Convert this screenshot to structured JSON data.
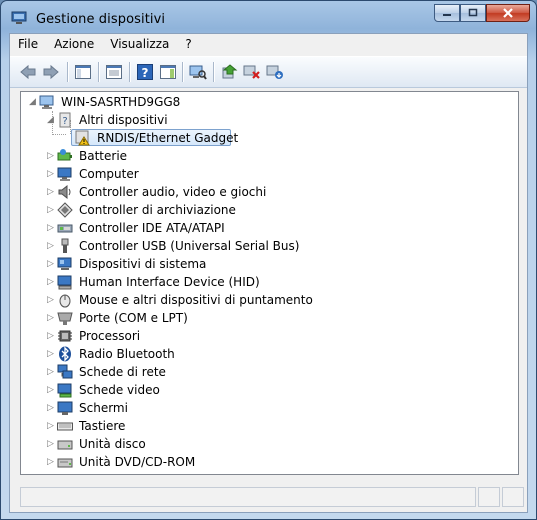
{
  "window": {
    "title": "Gestione dispositivi"
  },
  "menu": [
    "File",
    "Azione",
    "Visualizza",
    "?"
  ],
  "toolbar": {
    "buttons": [
      "back-icon",
      "forward-icon",
      "show-hide-console-tree-icon",
      "properties-icon",
      "help-icon",
      "action-pane-icon",
      "scan-hardware-icon",
      "update-driver-icon",
      "disable-device-icon",
      "uninstall-device-icon"
    ]
  },
  "tree": {
    "root": "WIN-SASRTHD9GG8",
    "expanded_category": "Altri dispositivi",
    "selected_device": "RNDIS/Ethernet Gadget",
    "categories": [
      "Batterie",
      "Computer",
      "Controller audio, video e giochi",
      "Controller di archiviazione",
      "Controller IDE ATA/ATAPI",
      "Controller USB (Universal Serial Bus)",
      "Dispositivi di sistema",
      "Human Interface Device (HID)",
      "Mouse e altri dispositivi di puntamento",
      "Porte (COM e LPT)",
      "Processori",
      "Radio Bluetooth",
      "Schede di rete",
      "Schede video",
      "Schermi",
      "Tastiere",
      "Unità disco",
      "Unità DVD/CD-ROM"
    ]
  },
  "colors": {
    "selection_border": "#7da2ce",
    "warning": "#f2c318",
    "close_button": "#c23b22"
  }
}
